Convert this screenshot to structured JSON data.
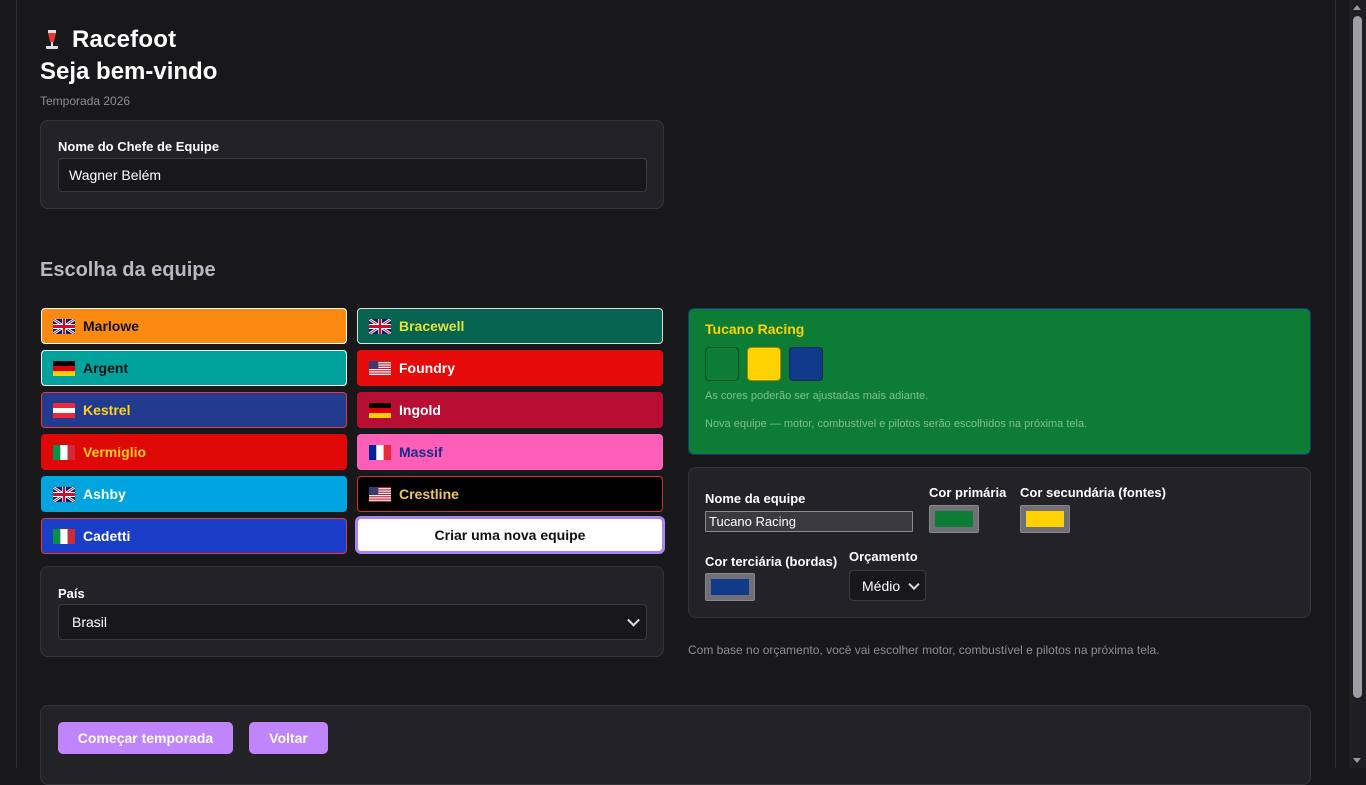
{
  "header": {
    "brand": "Racefoot",
    "welcome": "Seja bem-vindo",
    "season": "Temporada 2026"
  },
  "manager": {
    "label": "Nome do Chefe de Equipe",
    "value": "Wagner Belém"
  },
  "team_section": {
    "title": "Escolha da equipe",
    "teams": [
      {
        "name": "Marlowe",
        "flag": "uk-flag",
        "bg": "#fd8a10",
        "text": "#111111",
        "border": "#ffffff"
      },
      {
        "name": "Bracewell",
        "flag": "uk-flag",
        "bg": "#056350",
        "text": "#e6e232",
        "border": "#e0e0e0"
      },
      {
        "name": "Argent",
        "flag": "germany-flag",
        "bg": "#00a39c",
        "text": "#111111",
        "border": "#ffffff"
      },
      {
        "name": "Foundry",
        "flag": "usa-flag",
        "bg": "#e60a0a",
        "text": "#ffffff",
        "border": "#e60a0a"
      },
      {
        "name": "Kestrel",
        "flag": "austria-flag",
        "bg": "#223b8f",
        "text": "#ffd21c",
        "border": "#e53935"
      },
      {
        "name": "Ingold",
        "flag": "germany-flag",
        "bg": "#b80e34",
        "text": "#ffffff",
        "border": "#b80e34"
      },
      {
        "name": "Vermiglio",
        "flag": "italy-flag",
        "bg": "#e00707",
        "text": "#ffd21c",
        "border": "#e00707"
      },
      {
        "name": "Massif",
        "flag": "france-flag",
        "bg": "#ff5fb6",
        "text": "#1b2b8f",
        "border": "#ff5fb6"
      },
      {
        "name": "Ashby",
        "flag": "uk-flag",
        "bg": "#00a5e0",
        "text": "#ffffff",
        "border": "#00a5e0"
      },
      {
        "name": "Crestline",
        "flag": "usa-flag",
        "bg": "#000000",
        "text": "#e9c46a",
        "border": "#d32f2f"
      },
      {
        "name": "Cadetti",
        "flag": "italy-flag",
        "bg": "#1b3ec9",
        "text": "#ffffff",
        "border": "#e53935"
      }
    ],
    "create_label": "Criar uma nova equipe"
  },
  "country": {
    "label": "País",
    "value": "Brasil"
  },
  "preview": {
    "name": "Tucano Racing",
    "note1": "As cores poderão ser ajustadas mais adiante.",
    "note2": "Nova equipe — motor, combustível e pilotos serão escolhidos na próxima tela."
  },
  "form": {
    "team_name_label": "Nome da equipe",
    "team_name_value": "Tucano Racing",
    "primary_label": "Cor primária",
    "secondary_label": "Cor secundária (fontes)",
    "tertiary_label": "Cor terciária (bordas)",
    "budget_label": "Orçamento",
    "budget_value": "Médio"
  },
  "colors": {
    "primary": "#0d7d35",
    "secondary": "#ffd200",
    "tertiary": "#0f3a8a"
  },
  "footnote": "Com base no orçamento, você vai escolher motor, combustível e pilotos na próxima tela.",
  "actions": {
    "start": "Começar temporada",
    "back": "Voltar"
  }
}
